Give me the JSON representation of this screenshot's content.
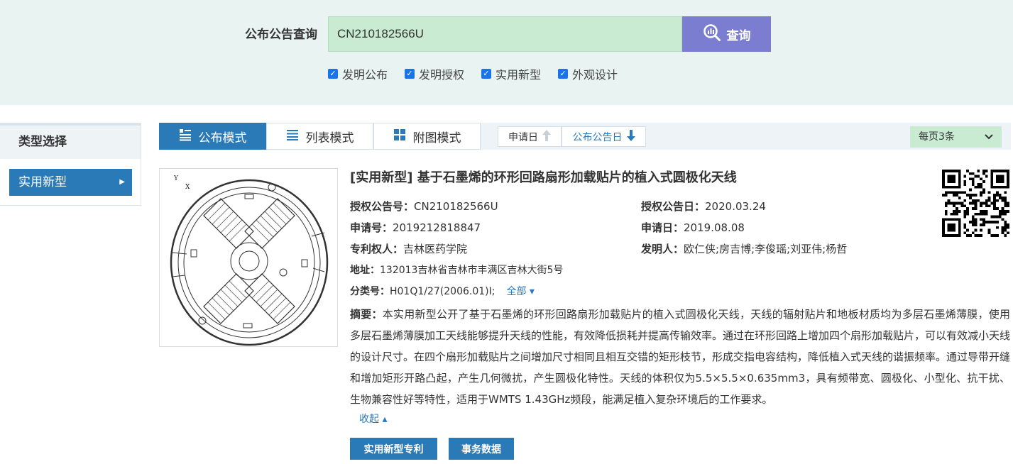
{
  "search": {
    "label": "公布公告查询",
    "value": "CN210182566U",
    "button_label": "查询",
    "button_icon": "search-chart-icon",
    "filters": [
      {
        "label": "发明公布",
        "checked": true
      },
      {
        "label": "发明授权",
        "checked": true
      },
      {
        "label": "实用新型",
        "checked": true
      },
      {
        "label": "外观设计",
        "checked": true
      }
    ]
  },
  "sidebar": {
    "title": "类型选择",
    "items": [
      {
        "label": "实用新型",
        "active": true
      }
    ]
  },
  "toolbar": {
    "modes": [
      {
        "label": "公布模式",
        "icon": "list-detail-icon",
        "active": true
      },
      {
        "label": "列表模式",
        "icon": "list-lines-icon",
        "active": false
      },
      {
        "label": "附图模式",
        "icon": "grid-icon",
        "active": false
      }
    ],
    "sorts": [
      {
        "label": "申请日",
        "icon": "arrow-up-icon",
        "active": false
      },
      {
        "label": "公布公告日",
        "icon": "arrow-down-icon",
        "active": true
      }
    ],
    "per_page": "每页3条"
  },
  "result": {
    "title": "[实用新型] 基于石墨烯的环形回路扇形加载贴片的植入式圆极化天线",
    "grant_no_label": "授权公告号：",
    "grant_no": "CN210182566U",
    "grant_date_label": "授权公告日：",
    "grant_date": "2020.03.24",
    "app_no_label": "申请号：",
    "app_no": "2019212818847",
    "app_date_label": "申请日：",
    "app_date": "2019.08.08",
    "owner_label": "专利权人：",
    "owner": "吉林医药学院",
    "inventor_label": "发明人：",
    "inventor": "欧仁侠;房吉博;李俊瑶;刘亚伟;杨哲",
    "address_label": "地址：",
    "address": "132013吉林省吉林市丰满区吉林大街5号",
    "class_label": "分类号：",
    "class_no": "H01Q1/27(2006.01)I;",
    "class_all": "全部",
    "abstract_label": "摘要：",
    "abstract": "本实用新型公开了基于石墨烯的环形回路扇形加载贴片的植入式圆极化天线，天线的辐射贴片和地板材质均为多层石墨烯薄膜，使用多层石墨烯薄膜加工天线能够提升天线的性能，有效降低损耗并提高传输效率。通过在环形回路上增加四个扇形加载贴片，可以有效减小天线的设计尺寸。在四个扇形加载贴片之间增加尺寸相同且相互交错的矩形枝节，形成交指电容结构，降低植入式天线的谐振频率。通过导带开缝和增加矩形开路凸起，产生几何微扰，产生圆极化特性。天线的体积仅为5.5×5.5×0.635mm3，具有频带宽、圆极化、小型化、抗干扰、生物兼容性好等特性，适用于WMTS 1.43GHz频段，能满足植入复杂环境后的工作要求。",
    "collapse_label": "收起",
    "buttons": [
      "实用新型专利",
      "事务数据"
    ]
  },
  "colors": {
    "header_bg": "#e9f3f1",
    "input_bg": "#c8ebd2",
    "search_button": "#7b7dd0",
    "primary": "#2a7ab8"
  }
}
